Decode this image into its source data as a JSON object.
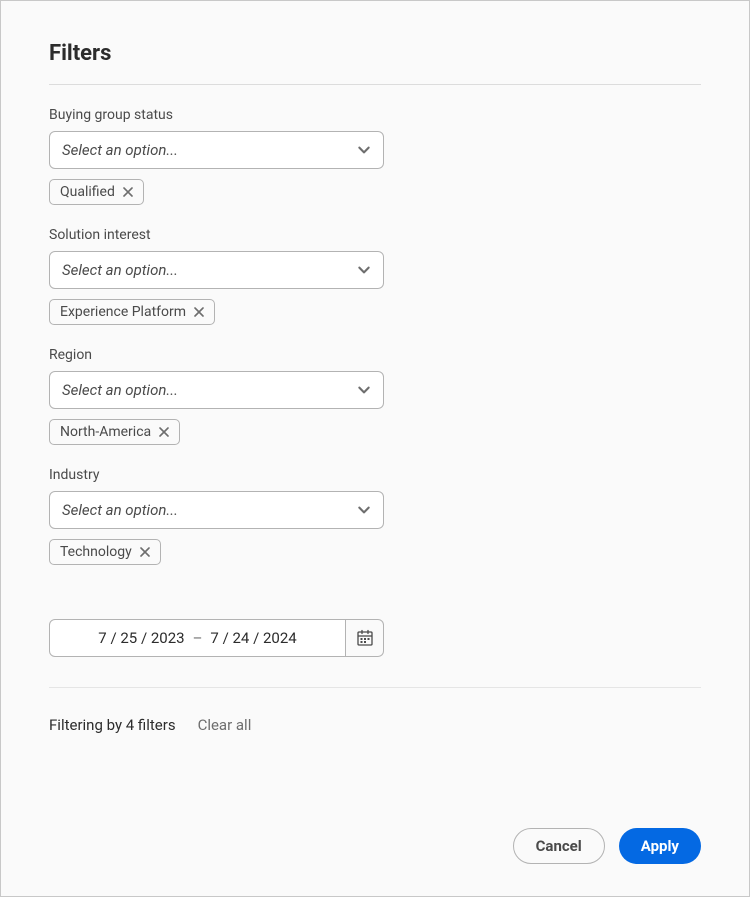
{
  "title": "Filters",
  "fields": {
    "buying_group_status": {
      "label": "Buying group status",
      "placeholder": "Select an option...",
      "tags": [
        "Qualified"
      ]
    },
    "solution_interest": {
      "label": "Solution interest",
      "placeholder": "Select an option...",
      "tags": [
        "Experience Platform"
      ]
    },
    "region": {
      "label": "Region",
      "placeholder": "Select an option...",
      "tags": [
        "North-America"
      ]
    },
    "industry": {
      "label": "Industry",
      "placeholder": "Select an option...",
      "tags": [
        "Technology"
      ]
    }
  },
  "date_range": {
    "start": "7 / 25 / 2023",
    "separator": "–",
    "end": "7 / 24 / 2024"
  },
  "summary": {
    "text": "Filtering by 4 filters",
    "clear_all": "Clear all"
  },
  "buttons": {
    "cancel": "Cancel",
    "apply": "Apply"
  }
}
